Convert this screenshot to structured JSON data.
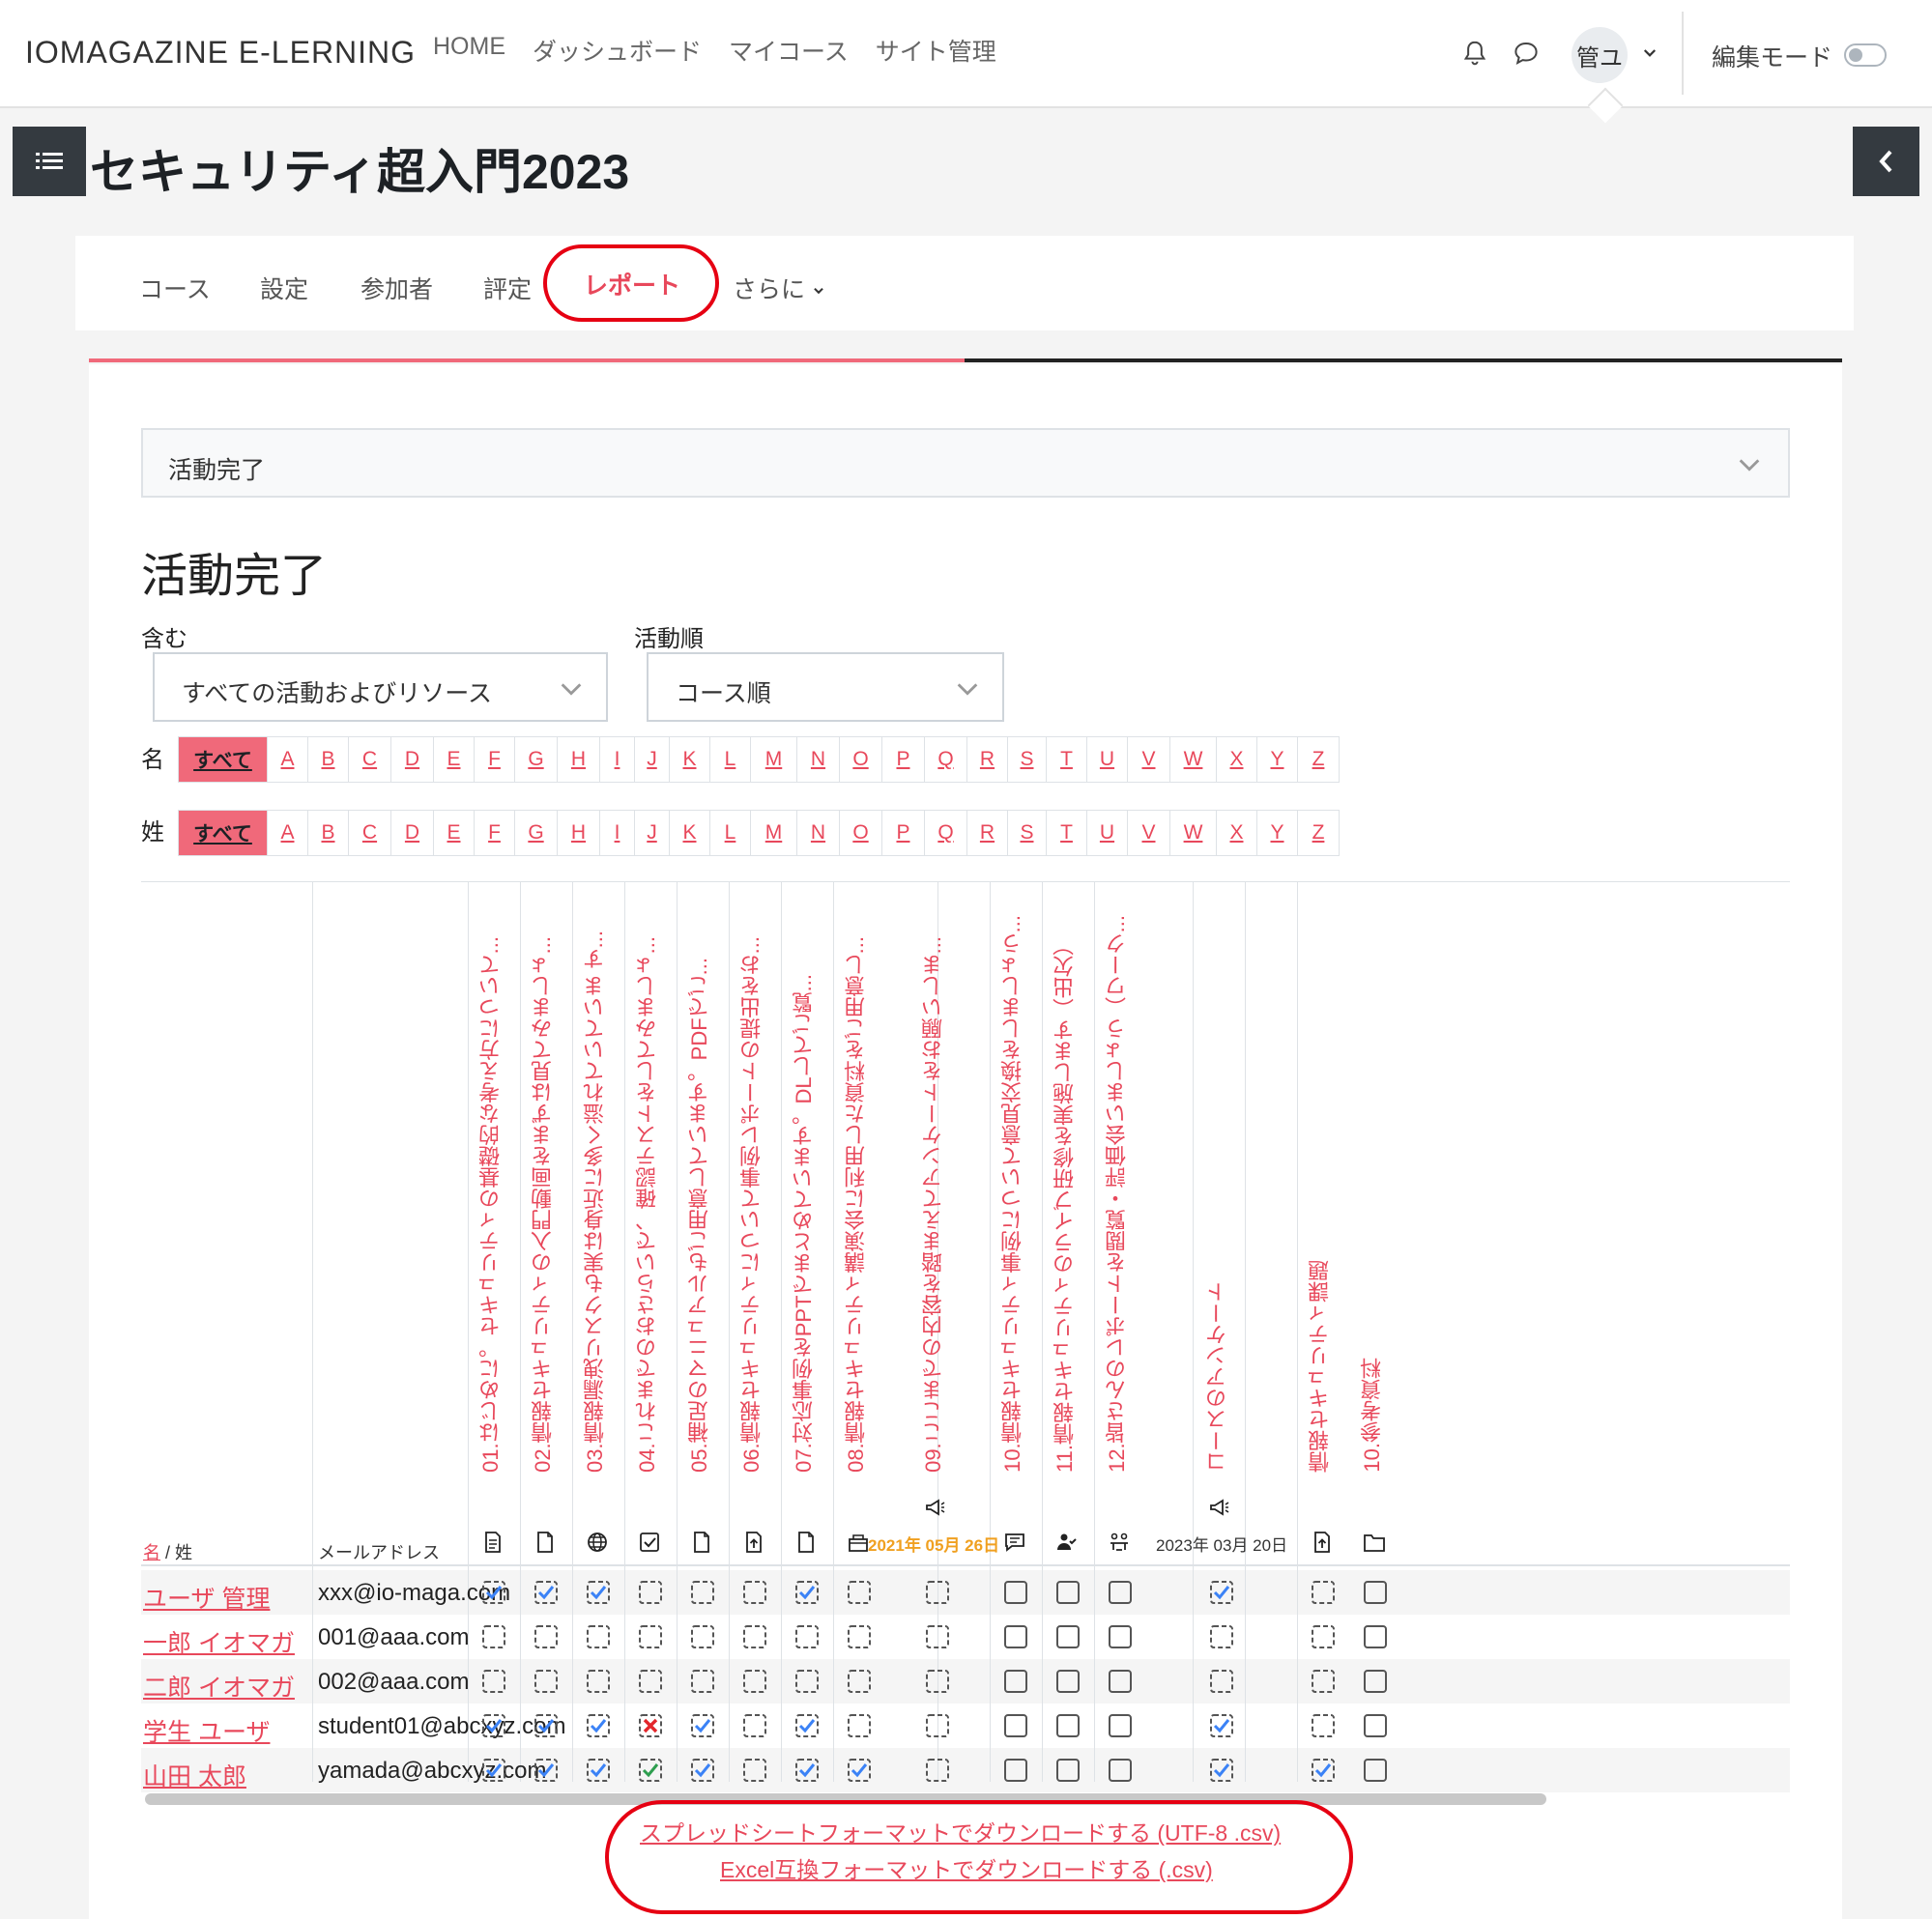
{
  "navbar": {
    "brand": "IOMAGAZINE E-LERNING",
    "links": [
      "HOME",
      "ダッシュボード",
      "マイコース",
      "サイト管理"
    ],
    "user_initials": "管ユ",
    "edit_mode_label": "編集モード"
  },
  "page": {
    "title": "セキュリティ超入門2023"
  },
  "secondary_nav": {
    "tabs": [
      "コース",
      "設定",
      "参加者",
      "評定",
      "レポート",
      "さらに"
    ],
    "active": "レポート"
  },
  "report_selector": {
    "value": "活動完了"
  },
  "heading": "活動完了",
  "filters": {
    "include_label": "含む",
    "include_value": "すべての活動およびリソース",
    "order_label": "活動順",
    "order_value": "コース順"
  },
  "initials": {
    "first_label": "名",
    "last_label": "姓",
    "all_label": "すべて",
    "letters": [
      "A",
      "B",
      "C",
      "D",
      "E",
      "F",
      "G",
      "H",
      "I",
      "J",
      "K",
      "L",
      "M",
      "N",
      "O",
      "P",
      "Q",
      "R",
      "S",
      "T",
      "U",
      "V",
      "W",
      "X",
      "Y",
      "Z"
    ]
  },
  "table": {
    "name_header_first": "名",
    "name_header_sep": " / ",
    "name_header_last": "姓",
    "email_header": "メールアドレス",
    "activities": [
      {
        "title": "01.はじめに。セキュリティの基礎的な考え方について...",
        "icon": "page-icon",
        "date": ""
      },
      {
        "title": "02.情報セキュリティの入門動画をまずは見てみましょ...",
        "icon": "file-icon",
        "date": ""
      },
      {
        "title": "03.情報漏洩リスクも実は身近に多く溢れていていま す...",
        "icon": "url-icon",
        "date": ""
      },
      {
        "title": "04.これまでのおさらいで、確認テストをしてみましょ...",
        "icon": "quiz-icon",
        "date": ""
      },
      {
        "title": "05.補足のマニュアルもご用意しています。PDFでご...",
        "icon": "file-icon",
        "date": ""
      },
      {
        "title": "06.情報セキュリティについて事例レポートの提出をお...",
        "icon": "assignment-icon",
        "date": ""
      },
      {
        "title": "07.対応事例をPPTでまとめています。DLしてご覧...",
        "icon": "file-icon",
        "date": ""
      },
      {
        "title": "08.情報セキュリティ講演会に利用した資料をご用意し...",
        "icon": "book-icon",
        "date": ""
      },
      {
        "title": "09.ここまでの内容を踏まえてアンケートをお願いしま...",
        "icon": "feedback-icon",
        "date": "2021年 05月 26日"
      },
      {
        "title": "10.情報セキュリティ事例について意見交換をしましょう...",
        "icon": "forum-icon",
        "date": ""
      },
      {
        "title": "11.情報セキュリティのライブ研修を実施します（出欠）",
        "icon": "attendance-icon",
        "date": ""
      },
      {
        "title": "12.皆さんのレポートを閲覧・評価会いましょう（ワーク...",
        "icon": "workshop-icon",
        "date": ""
      },
      {
        "title": "コースのアンケート",
        "icon": "feedback-icon",
        "date": "2023年 03月 20日"
      },
      {
        "title": "情報セキュリティ課題",
        "icon": "assignment-icon",
        "date": ""
      },
      {
        "title": "10.参考資料",
        "icon": "folder-icon",
        "date": ""
      }
    ],
    "rows": [
      {
        "name": "ユーザ 管理",
        "email": "xxx@io-maga.com",
        "status": [
          "blue",
          "blue",
          "blue",
          "empty",
          "empty",
          "empty",
          "blue",
          "empty",
          "empty",
          "empty",
          "empty",
          "empty",
          "blue",
          "empty",
          "empty"
        ]
      },
      {
        "name": "一郎 イオマガ",
        "email": "001@aaa.com",
        "status": [
          "empty",
          "empty",
          "empty",
          "empty",
          "empty",
          "empty",
          "empty",
          "empty",
          "empty",
          "empty",
          "empty",
          "empty",
          "empty",
          "empty",
          "empty"
        ]
      },
      {
        "name": "二郎 イオマガ",
        "email": "002@aaa.com",
        "status": [
          "empty",
          "empty",
          "empty",
          "empty",
          "empty",
          "empty",
          "empty",
          "empty",
          "empty",
          "empty",
          "empty",
          "empty",
          "empty",
          "empty",
          "empty"
        ]
      },
      {
        "name": "学生 ユーザ",
        "email": "student01@abcxyz.com",
        "status": [
          "blue",
          "blue",
          "blue",
          "fail",
          "blue",
          "empty",
          "blue",
          "empty",
          "empty",
          "empty",
          "empty",
          "empty",
          "blue",
          "empty",
          "empty"
        ]
      },
      {
        "name": "山田 太郎",
        "email": "yamada@abcxyz.com",
        "status": [
          "blue",
          "blue",
          "blue",
          "green",
          "blue",
          "empty",
          "blue",
          "blue",
          "empty",
          "empty",
          "empty",
          "empty",
          "blue",
          "blue",
          "empty"
        ]
      }
    ]
  },
  "downloads": {
    "utf8": "スプレッドシートフォーマットでダウンロードする (UTF-8 .csv)",
    "excel": "Excel互換フォーマットでダウンロードする (.csv)"
  },
  "colors": {
    "accent": "#e8485b",
    "accent_bg": "#f0697a",
    "annotation_red": "#e60012",
    "check_blue": "#3b82f6",
    "check_green": "#2e9e4f",
    "fail_red": "#e3262b",
    "date_orange": "#f0a020"
  }
}
